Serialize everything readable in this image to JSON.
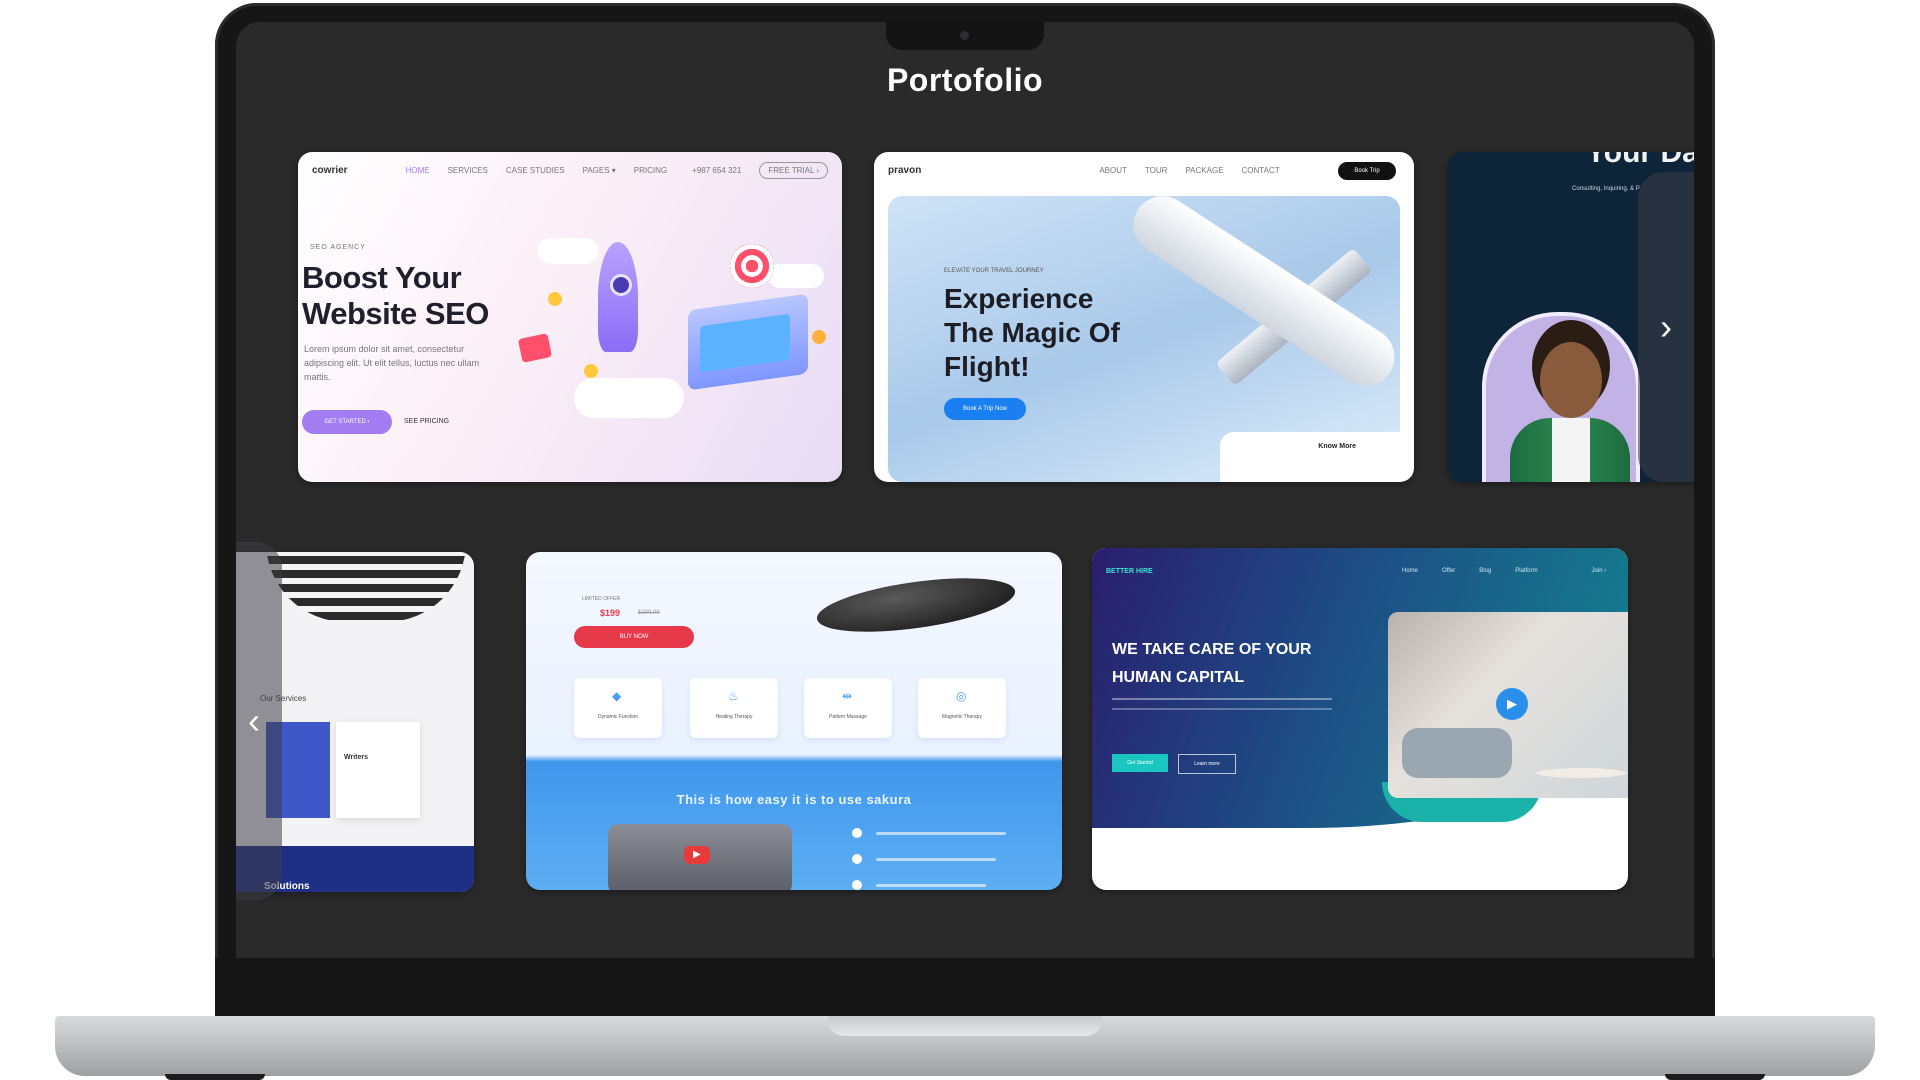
{
  "page": {
    "title": "Portofolio"
  },
  "colors": {
    "screen_bg": "#2a2a2a",
    "accent_purple": "#a27cf0",
    "accent_blue": "#1a7ff0",
    "accent_red": "#e6394a",
    "accent_teal": "#1bc6c0"
  },
  "carousel": {
    "next_icon": "chevron-right-icon",
    "prev_icon": "chevron-left-icon",
    "next_glyph": "›",
    "prev_glyph": "‹",
    "cards": {
      "seo": {
        "logo": "cowrier",
        "nav": [
          "HOME",
          "SERVICES",
          "CASE STUDIES",
          "PAGES ▾",
          "PRICING"
        ],
        "phone": "+987 654 321",
        "trial": "FREE TRIAL ›",
        "tag": "SEO AGENCY",
        "headline": "Boost Your\nWebsite SEO",
        "body": "Lorem ipsum dolor sit amet, consectetur adipiscing elit. Ut elit tellus, luctus nec ullam mattis.",
        "cta": "GET STARTED ›",
        "cta2": "SEE PRICING"
      },
      "flight": {
        "logo": "pravon",
        "nav": [
          "ABOUT",
          "TOUR",
          "PACKAGE",
          "CONTACT"
        ],
        "book": "Book Trip",
        "eyebrow": "ELEVATE YOUR TRAVEL JOURNEY",
        "headline": "Experience\nThe Magic Of\nFlight!",
        "cta": "Book A Trip Now",
        "know_more": "Know More"
      },
      "person": {
        "title_fragment": "Your Da",
        "sub_fragment": "Consulting, Inquiring, & P"
      },
      "left_partial": {
        "services": "Our Services",
        "card_label": "Writers",
        "bottom_text": "Solutions"
      },
      "sakura": {
        "price_label": "LIMITED OFFER",
        "price": "$199",
        "old_price": "$299.00",
        "buy": "BUY NOW",
        "features": [
          "Dynamic Function",
          "Heating Therapy",
          "Pattern Massage",
          "Magnetic Therapy"
        ],
        "how": "This is how easy it is to use sakura"
      },
      "capital": {
        "brand": "BETTER HIRE",
        "nav": [
          "Home",
          "Offer",
          "Blog",
          "Platform",
          "Join ›"
        ],
        "headline": "WE TAKE CARE OF YOUR\nHUMAN CAPITAL",
        "btn1": "Get Started",
        "btn2": "Learn more"
      }
    }
  }
}
